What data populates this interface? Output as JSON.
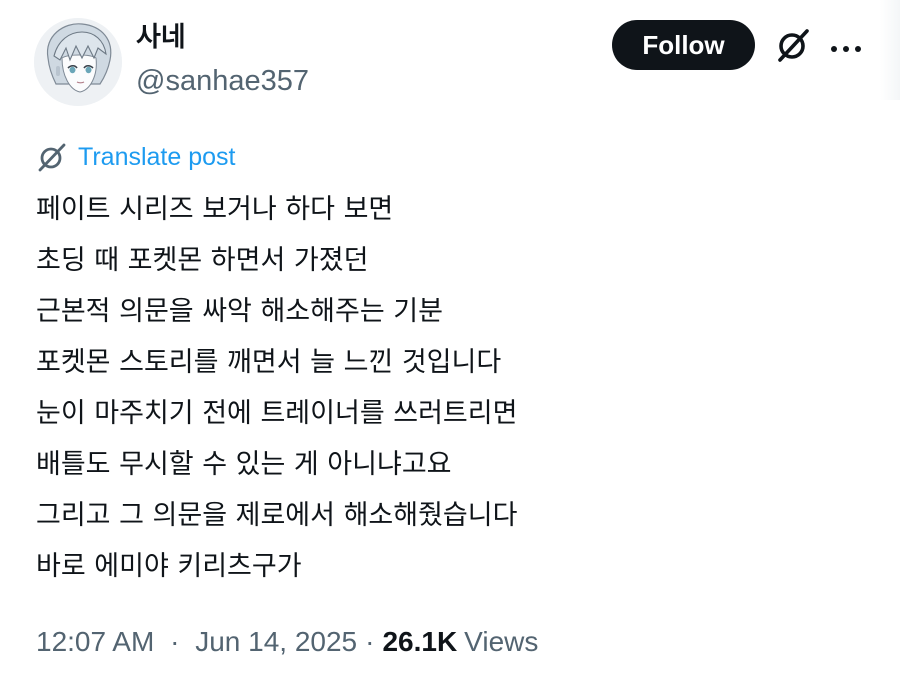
{
  "author": {
    "display_name": "사네",
    "handle": "@sanhae357",
    "avatar_icon": "anime-avatar-icon"
  },
  "actions": {
    "follow_label": "Follow",
    "grok_icon": "grok-icon",
    "more_icon": "more-dots-icon"
  },
  "translate": {
    "icon": "grok-icon",
    "label": "Translate post",
    "color": "#1d9bf0"
  },
  "post": {
    "lines": [
      "페이트 시리즈 보거나 하다 보면",
      "초딩 때 포켓몬 하면서 가졌던",
      "근본적 의문을 싸악 해소해주는 기분",
      "포켓몬 스토리를 깨면서 늘 느낀 것입니다",
      "눈이 마주치기 전에 트레이너를 쓰러트리면",
      "배틀도 무시할 수 있는 게 아니냐고요",
      "그리고 그 의문을 제로에서 해소해줬습니다",
      "바로 에미야 키리츠구가"
    ]
  },
  "meta": {
    "time": "12:07 AM",
    "separator": "·",
    "date": "Jun 14, 2025",
    "views_count": "26.1K",
    "views_label": "Views"
  },
  "colors": {
    "text": "#0f1419",
    "muted": "#536471",
    "button_bg": "#0f1419",
    "link": "#1d9bf0"
  }
}
